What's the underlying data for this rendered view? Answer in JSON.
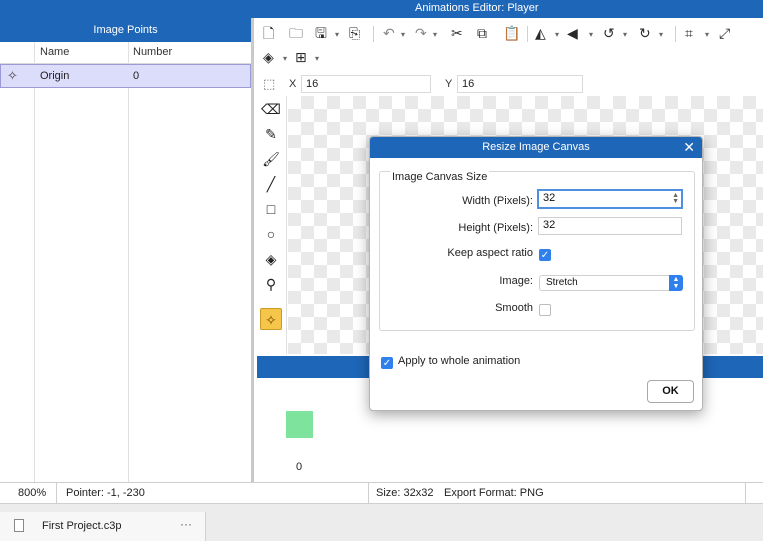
{
  "window": {
    "title": "Animations Editor: Player"
  },
  "image_points": {
    "header": "Image Points",
    "columns": [
      "Name",
      "Number"
    ],
    "rows": [
      {
        "name": "Origin",
        "number": "0"
      }
    ]
  },
  "toolbar": {
    "icons": [
      "new-file-icon",
      "open-folder-icon",
      "save-icon",
      "export-icon",
      "undo-icon",
      "redo-icon",
      "cut-icon",
      "copy-icon",
      "paste-icon",
      "flip-horizontal-icon",
      "flip-vertical-icon",
      "rotate-left-icon",
      "rotate-right-icon",
      "crop-icon",
      "resize-icon",
      "layers-icon",
      "grid-icon"
    ]
  },
  "position": {
    "x_label": "X",
    "x_value": "16",
    "y_label": "Y",
    "y_value": "16"
  },
  "tools": [
    "eraser-icon",
    "pencil-icon",
    "brush-icon",
    "line-icon",
    "rectangle-icon",
    "ellipse-icon",
    "fill-icon",
    "color-picker-icon",
    "image-point-icon"
  ],
  "frames": {
    "items": [
      {
        "number": "0",
        "color": "#7ee39c"
      }
    ]
  },
  "statusbar": {
    "zoom": "800%",
    "pointer": "Pointer: -1, -230",
    "size": "Size: 32x32",
    "export_format": "Export Format: PNG"
  },
  "project_tab": {
    "name": "First Project.c3p",
    "more": "···"
  },
  "dialog": {
    "title": "Resize Image Canvas",
    "group_label": "Image Canvas Size",
    "width_label": "Width (Pixels):",
    "width_value": "32",
    "height_label": "Height (Pixels):",
    "height_value": "32",
    "keep_aspect_label": "Keep aspect ratio",
    "keep_aspect_checked": true,
    "image_label": "Image:",
    "image_value": "Stretch",
    "smooth_label": "Smooth",
    "smooth_checked": false,
    "apply_label": "Apply to whole animation",
    "apply_checked": true,
    "ok_label": "OK"
  },
  "colors": {
    "accent": "#1e66b8",
    "selection": "#dcdcfb",
    "active_tool": "#f6c64a",
    "checkbox": "#2f80ed"
  }
}
